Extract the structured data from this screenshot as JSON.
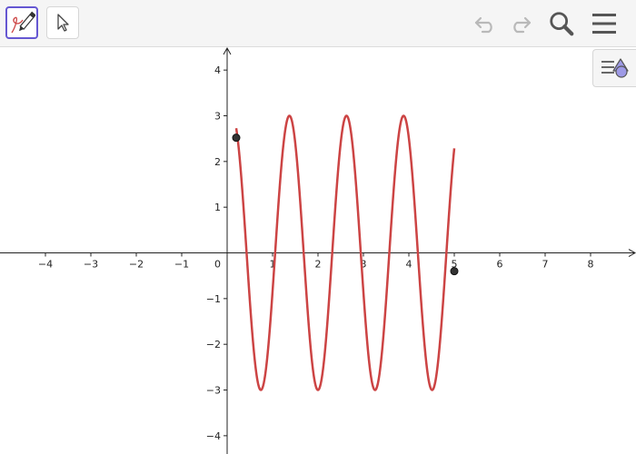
{
  "toolbar": {
    "tools": [
      "pen-tool",
      "move-tool"
    ],
    "icons": [
      "undo-icon",
      "redo-icon",
      "search-icon",
      "menu-icon"
    ]
  },
  "style_bar": {
    "icon": "style-bar-toggle-icon"
  },
  "colors": {
    "curve": "#cc4444",
    "accent": "#6557d2",
    "point": "#333333",
    "icon_disabled": "#b9b9b9",
    "icon": "#555555"
  },
  "chart_data": {
    "type": "line",
    "xlim": [
      -5,
      9
    ],
    "ylim": [
      -4.4,
      4.5
    ],
    "x_ticks": [
      -4,
      -3,
      -2,
      -1,
      1,
      2,
      3,
      4,
      5,
      6,
      7,
      8
    ],
    "y_ticks": [
      -4,
      -3,
      -2,
      -1,
      1,
      2,
      3,
      4
    ],
    "origin_label": "0",
    "grid": false,
    "function": {
      "amplitude": 3,
      "angular_frequency": 5,
      "phase": 1,
      "domain": [
        0.2,
        5
      ]
    },
    "points": [
      {
        "x": 0.2,
        "y": 2.52
      },
      {
        "x": 5,
        "y": -0.4
      }
    ]
  }
}
